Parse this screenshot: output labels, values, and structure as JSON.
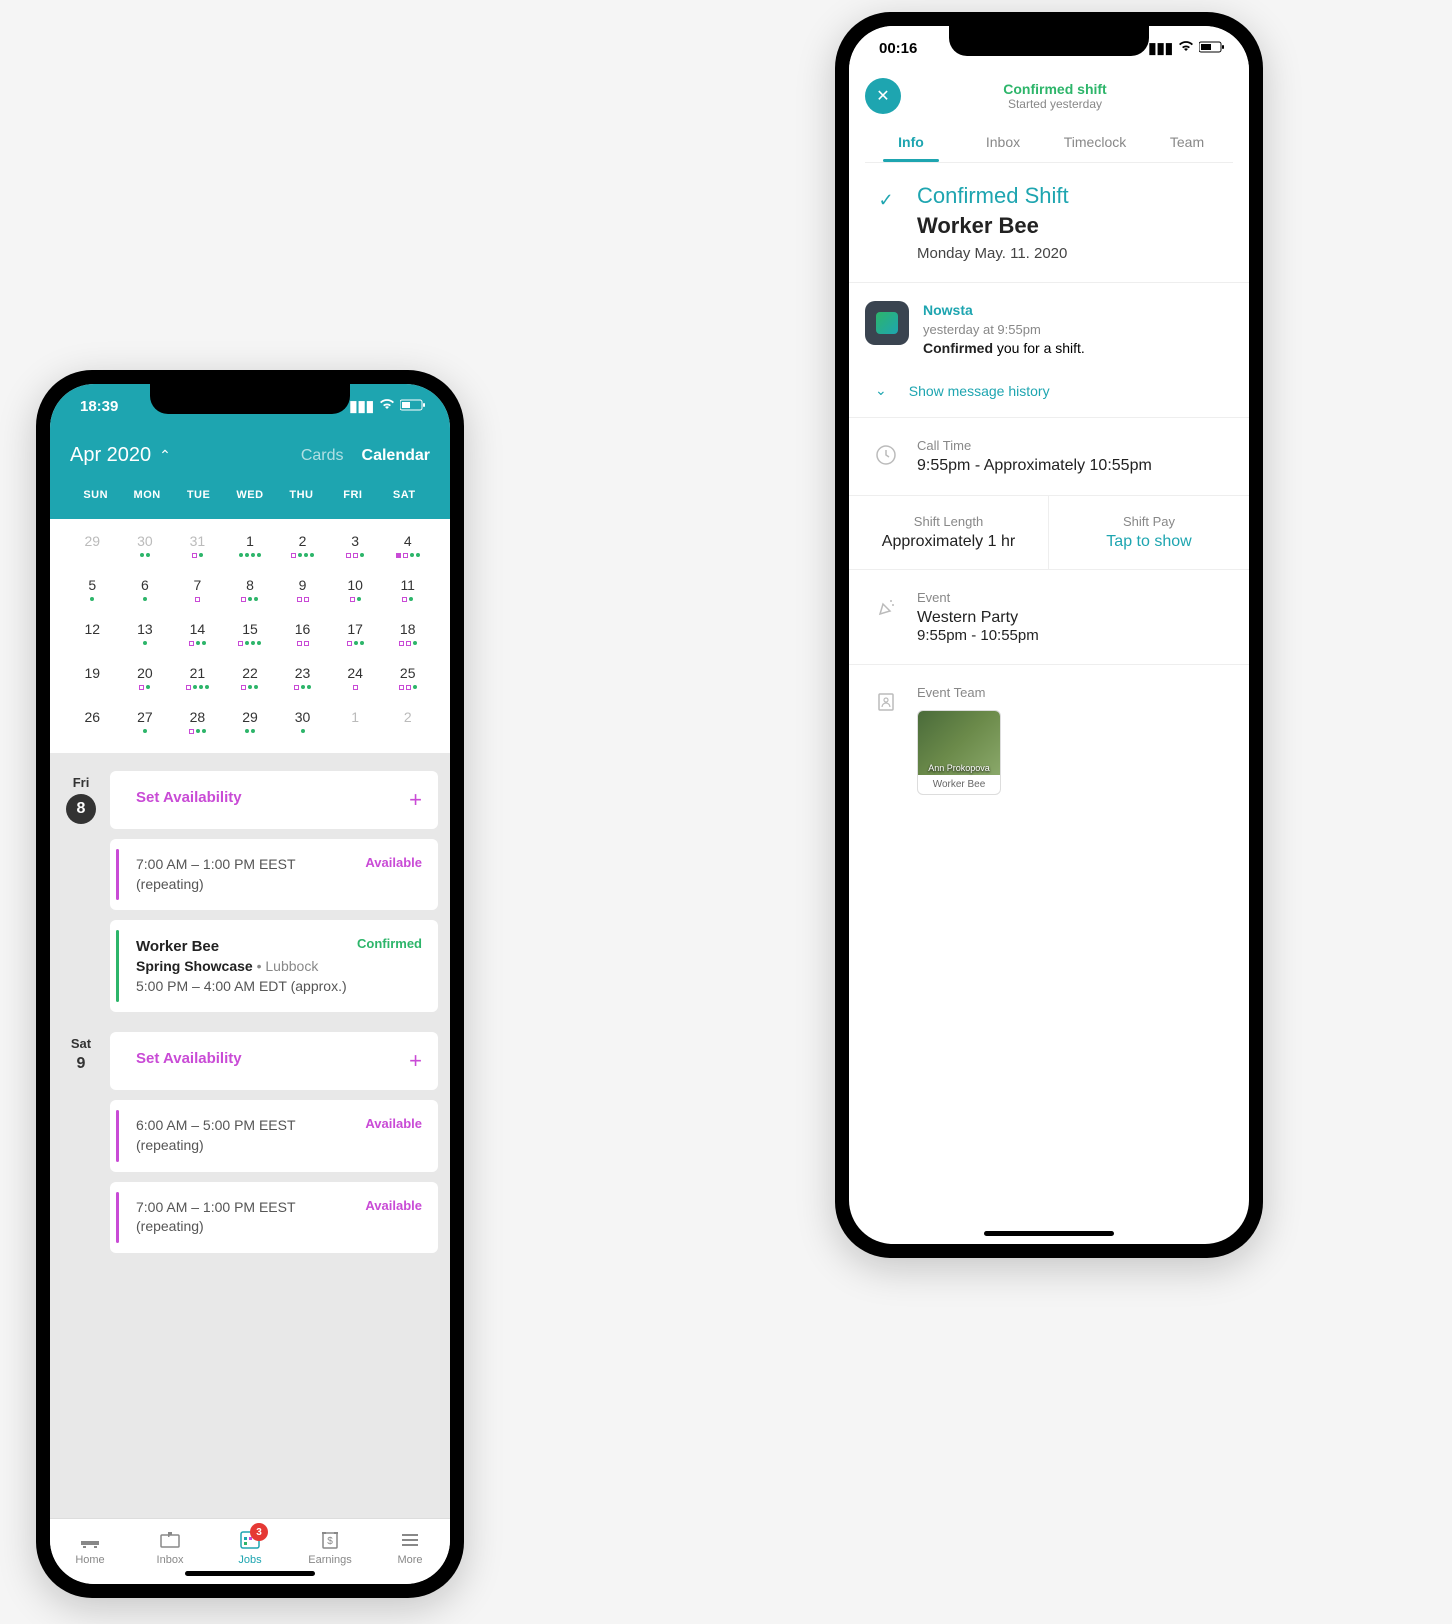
{
  "phone1": {
    "status": {
      "time": "18:39"
    },
    "header": {
      "month": "Apr 2020",
      "view_cards": "Cards",
      "view_calendar": "Calendar"
    },
    "dow": [
      "SUN",
      "MON",
      "TUE",
      "WED",
      "THU",
      "FRI",
      "SAT"
    ],
    "grid": [
      {
        "n": "29",
        "muted": true,
        "dots": []
      },
      {
        "n": "30",
        "muted": true,
        "dots": [
          "g",
          "g"
        ]
      },
      {
        "n": "31",
        "muted": true,
        "dots": [
          "p",
          "g"
        ]
      },
      {
        "n": "1",
        "dots": [
          "g",
          "g",
          "g",
          "g"
        ]
      },
      {
        "n": "2",
        "dots": [
          "p",
          "g",
          "g",
          "g"
        ]
      },
      {
        "n": "3",
        "dots": [
          "p",
          "p",
          "g"
        ]
      },
      {
        "n": "4",
        "dots": [
          "pf",
          "p",
          "g",
          "g"
        ]
      },
      {
        "n": "5",
        "dots": [
          "g"
        ]
      },
      {
        "n": "6",
        "dots": [
          "g"
        ]
      },
      {
        "n": "7",
        "dots": [
          "p"
        ]
      },
      {
        "n": "8",
        "dots": [
          "p",
          "g",
          "g"
        ]
      },
      {
        "n": "9",
        "dots": [
          "p",
          "p"
        ]
      },
      {
        "n": "10",
        "dots": [
          "p",
          "g"
        ]
      },
      {
        "n": "11",
        "dots": [
          "p",
          "g"
        ]
      },
      {
        "n": "12",
        "dots": []
      },
      {
        "n": "13",
        "dots": [
          "g"
        ]
      },
      {
        "n": "14",
        "dots": [
          "p",
          "g",
          "g"
        ]
      },
      {
        "n": "15",
        "dots": [
          "p",
          "g",
          "g",
          "g"
        ]
      },
      {
        "n": "16",
        "dots": [
          "p",
          "p"
        ]
      },
      {
        "n": "17",
        "dots": [
          "p",
          "g",
          "g"
        ]
      },
      {
        "n": "18",
        "dots": [
          "p",
          "p",
          "g"
        ]
      },
      {
        "n": "19",
        "dots": []
      },
      {
        "n": "20",
        "dots": [
          "p",
          "g"
        ]
      },
      {
        "n": "21",
        "dots": [
          "p",
          "g",
          "g",
          "g"
        ]
      },
      {
        "n": "22",
        "dots": [
          "p",
          "g",
          "g"
        ]
      },
      {
        "n": "23",
        "dots": [
          "p",
          "g",
          "g"
        ]
      },
      {
        "n": "24",
        "dots": [
          "p"
        ]
      },
      {
        "n": "25",
        "dots": [
          "p",
          "p",
          "g"
        ]
      },
      {
        "n": "26",
        "dots": []
      },
      {
        "n": "27",
        "dots": [
          "g"
        ]
      },
      {
        "n": "28",
        "dots": [
          "p",
          "g",
          "g"
        ]
      },
      {
        "n": "29",
        "dots": [
          "g",
          "g"
        ]
      },
      {
        "n": "30",
        "dots": [
          "g"
        ]
      },
      {
        "n": "1",
        "muted": true,
        "dots": []
      },
      {
        "n": "2",
        "muted": true,
        "dots": []
      }
    ],
    "days": [
      {
        "dow": "Fri",
        "num": "8",
        "today": true,
        "cards": [
          {
            "type": "set",
            "title": "Set Availability"
          },
          {
            "type": "avail",
            "time": "7:00 AM – 1:00 PM EEST",
            "note": "(repeating)",
            "status": "Available"
          },
          {
            "type": "shift",
            "role": "Worker Bee",
            "event": "Spring Showcase",
            "loc": "Lubbock",
            "time": "5:00 PM – 4:00 AM EDT (approx.)",
            "status": "Confirmed"
          }
        ]
      },
      {
        "dow": "Sat",
        "num": "9",
        "today": false,
        "cards": [
          {
            "type": "set",
            "title": "Set Availability"
          },
          {
            "type": "avail",
            "time": "6:00 AM – 5:00 PM EEST",
            "note": "(repeating)",
            "status": "Available"
          },
          {
            "type": "avail",
            "time": "7:00 AM – 1:00 PM EEST",
            "note": "(repeating)",
            "status": "Available"
          }
        ]
      }
    ],
    "tabs": {
      "home": "Home",
      "inbox": "Inbox",
      "jobs": "Jobs",
      "earnings": "Earnings",
      "more": "More",
      "badge": "3"
    }
  },
  "phone2": {
    "status": {
      "time": "00:16"
    },
    "header": {
      "title": "Confirmed shift",
      "sub": "Started yesterday"
    },
    "tabs": [
      "Info",
      "Inbox",
      "Timeclock",
      "Team"
    ],
    "hero": {
      "title": "Confirmed Shift",
      "role": "Worker Bee",
      "date": "Monday May. 11. 2020"
    },
    "msg": {
      "from": "Nowsta",
      "time": "yesterday at 9:55pm",
      "action": "Confirmed",
      "tail": " you for a shift.",
      "show_history": "Show message history"
    },
    "call": {
      "label": "Call Time",
      "value": "9:55pm - Approximately 10:55pm"
    },
    "length": {
      "label": "Shift Length",
      "value": "Approximately 1 hr"
    },
    "pay": {
      "label": "Shift Pay",
      "value": "Tap to show"
    },
    "event": {
      "label": "Event",
      "name": "Western Party",
      "time": "9:55pm - 10:55pm"
    },
    "team": {
      "label": "Event Team",
      "member_name": "Ann Prokopova",
      "member_role": "Worker Bee"
    }
  }
}
